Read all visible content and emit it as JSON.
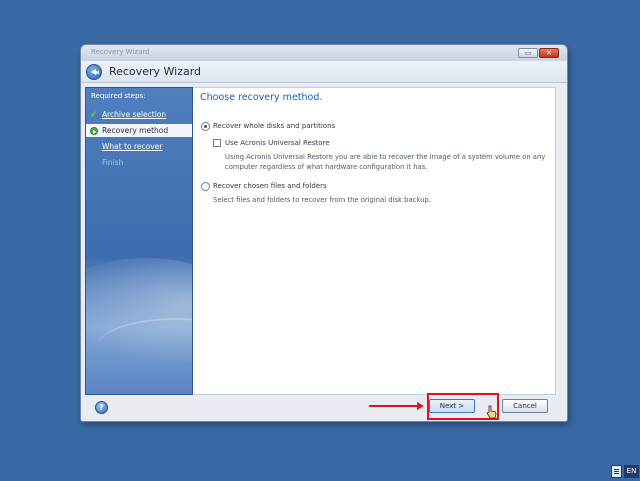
{
  "window": {
    "titlebar_text": "Recovery Wizard",
    "header_title": "Recovery Wizard",
    "minimize_glyph": "▭",
    "close_glyph": "✕"
  },
  "sidebar": {
    "label": "Required steps:",
    "steps": [
      {
        "label": "Archive selection",
        "state": "done",
        "icon": "check-icon"
      },
      {
        "label": "Recovery method",
        "state": "current",
        "icon": "current-step-icon"
      },
      {
        "label": "What to recover",
        "state": "pending",
        "icon": ""
      },
      {
        "label": "Finish",
        "state": "disabled",
        "icon": ""
      }
    ]
  },
  "main": {
    "heading": "Choose recovery method.",
    "options": {
      "whole_disks": {
        "label": "Recover whole disks and partitions",
        "selected": true
      },
      "universal_restore": {
        "label": "Use Acronis Universal Restore",
        "checked": false,
        "description": "Using Acronis Universal Restore you are able to recover the image of a system volume on any computer regardless of what hardware configuration it has."
      },
      "files_folders": {
        "label": "Recover chosen files and folders",
        "selected": false,
        "description": "Select files and folders to recover from the original disk backup."
      }
    }
  },
  "footer": {
    "help_glyph": "?",
    "next_label": "Next >",
    "cancel_label": "Cancel"
  },
  "taskbar": {
    "language": "EN"
  },
  "colors": {
    "desktop": "#3a6aa5",
    "heading": "#1d5fb4",
    "highlight_box": "#e0141a"
  }
}
